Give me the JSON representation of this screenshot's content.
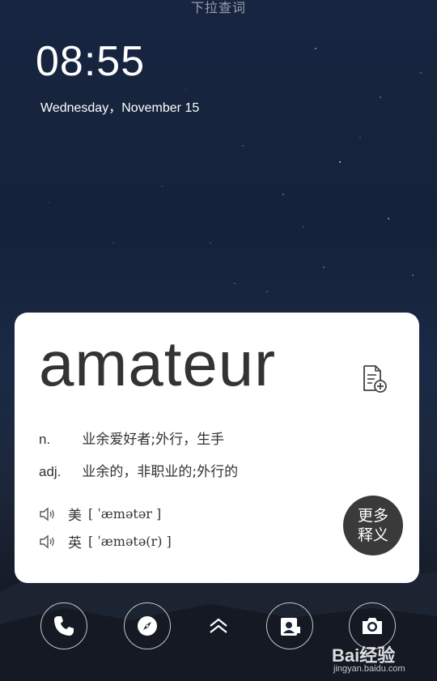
{
  "status": {
    "pull_hint": "下拉查词"
  },
  "lockscreen": {
    "time": "08:55",
    "date": "Wednesday，November 15"
  },
  "card": {
    "word": "amateur",
    "definitions": [
      {
        "pos": "n.",
        "meaning": "业余爱好者;外行，生手"
      },
      {
        "pos": "adj.",
        "meaning": "业余的，非职业的;外行的"
      }
    ],
    "pronunciations": [
      {
        "region": "美",
        "ipa": "[ ˈæmətər ]"
      },
      {
        "region": "英",
        "ipa": "[ ˈæmətə(r) ]"
      }
    ],
    "more_button": {
      "line1": "更多",
      "line2": "释义"
    },
    "icons": {
      "add_note": "document-add-icon",
      "speaker": "speaker-icon"
    }
  },
  "dock": {
    "icons": [
      "phone-icon",
      "compass-icon",
      "chevron-up-icon",
      "contacts-icon",
      "camera-icon"
    ]
  },
  "watermark": {
    "brand": "Bai经验",
    "url": "jingyan.baidu.com"
  },
  "colors": {
    "card_bg": "#ffffff",
    "text_dark": "#333333",
    "more_btn_bg": "#3a3a3a"
  }
}
